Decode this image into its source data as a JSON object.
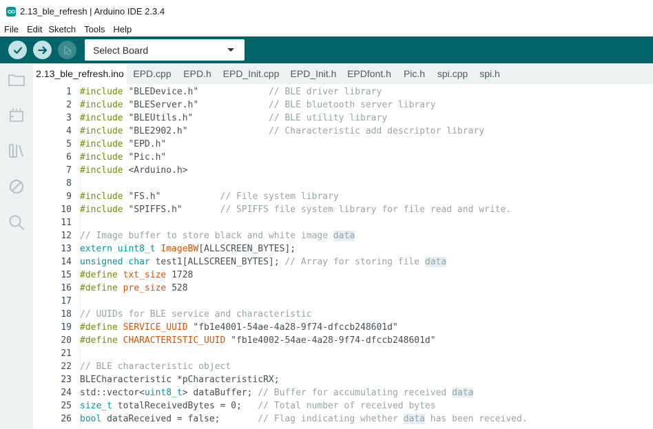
{
  "window": {
    "title": "2.13_ble_refresh | Arduino IDE 2.3.4"
  },
  "menu": [
    "File",
    "Edit",
    "Sketch",
    "Tools",
    "Help"
  ],
  "toolbar": {
    "verify_icon": "check-icon",
    "upload_icon": "arrow-right-icon",
    "debug_icon": "debug-icon",
    "board_select": "Select Board"
  },
  "sidebar": {
    "items": [
      "folder-icon",
      "board-icon",
      "library-icon",
      "debug-icon",
      "search-icon"
    ]
  },
  "tabs": [
    "2.13_ble_refresh.ino",
    "EPD.cpp",
    "EPD.h",
    "EPD_Init.cpp",
    "EPD_Init.h",
    "EPDfont.h",
    "Pic.h",
    "spi.cpp",
    "spi.h"
  ],
  "active_tab": "2.13_ble_refresh.ino",
  "colors": {
    "toolbar": "#006468",
    "keyword": "#728e00",
    "type": "#00979c",
    "comment": "#95a5a6",
    "define": "#d35400"
  },
  "code": [
    {
      "n": "1",
      "segs": [
        [
          "kw",
          "#include "
        ],
        [
          "str",
          "\"BLEDevice.h\""
        ],
        [
          "plain",
          "             "
        ],
        [
          "cmt",
          "// BLE driver library"
        ]
      ]
    },
    {
      "n": "2",
      "segs": [
        [
          "kw",
          "#include "
        ],
        [
          "str",
          "\"BLEServer.h\""
        ],
        [
          "plain",
          "             "
        ],
        [
          "cmt",
          "// BLE bluetooth server library"
        ]
      ]
    },
    {
      "n": "3",
      "segs": [
        [
          "kw",
          "#include "
        ],
        [
          "str",
          "\"BLEUtils.h\""
        ],
        [
          "plain",
          "              "
        ],
        [
          "cmt",
          "// BLE utility library"
        ]
      ]
    },
    {
      "n": "4",
      "segs": [
        [
          "kw",
          "#include "
        ],
        [
          "str",
          "\"BLE2902.h\""
        ],
        [
          "plain",
          "               "
        ],
        [
          "cmt",
          "// Characteristic add descriptor library"
        ]
      ]
    },
    {
      "n": "5",
      "segs": [
        [
          "kw",
          "#include "
        ],
        [
          "str",
          "\"EPD.h\""
        ]
      ]
    },
    {
      "n": "6",
      "segs": [
        [
          "kw",
          "#include "
        ],
        [
          "str",
          "\"Pic.h\""
        ]
      ]
    },
    {
      "n": "7",
      "segs": [
        [
          "kw",
          "#include "
        ],
        [
          "str",
          "<Arduino.h>"
        ]
      ]
    },
    {
      "n": "8",
      "segs": []
    },
    {
      "n": "9",
      "segs": [
        [
          "kw",
          "#include "
        ],
        [
          "str",
          "\"FS.h\""
        ],
        [
          "plain",
          "           "
        ],
        [
          "cmt",
          "// File system library"
        ]
      ]
    },
    {
      "n": "10",
      "segs": [
        [
          "kw",
          "#include "
        ],
        [
          "str",
          "\"SPIFFS.h\""
        ],
        [
          "plain",
          "       "
        ],
        [
          "cmt",
          "// SPIFFS file system library for file read and write."
        ]
      ]
    },
    {
      "n": "11",
      "segs": []
    },
    {
      "n": "12",
      "segs": [
        [
          "cmt",
          "// Image buffer to store black and white image "
        ],
        [
          "cmt-hl",
          "data"
        ]
      ]
    },
    {
      "n": "13",
      "segs": [
        [
          "type",
          "extern uint8_t "
        ],
        [
          "def",
          "ImageBW"
        ],
        [
          "plain",
          "[ALLSCREEN_BYTES];"
        ]
      ]
    },
    {
      "n": "14",
      "segs": [
        [
          "type",
          "unsigned char "
        ],
        [
          "plain",
          "test1[ALLSCREEN_BYTES]; "
        ],
        [
          "cmt",
          "// Array for storing file "
        ],
        [
          "cmt-hl",
          "data"
        ]
      ]
    },
    {
      "n": "15",
      "segs": [
        [
          "kw",
          "#define "
        ],
        [
          "def",
          "txt_size "
        ],
        [
          "num",
          "1728"
        ]
      ]
    },
    {
      "n": "16",
      "segs": [
        [
          "kw",
          "#define "
        ],
        [
          "def",
          "pre_size "
        ],
        [
          "num",
          "528"
        ]
      ]
    },
    {
      "n": "17",
      "segs": []
    },
    {
      "n": "18",
      "segs": [
        [
          "cmt",
          "// UUIDs for BLE service and characteristic"
        ]
      ]
    },
    {
      "n": "19",
      "segs": [
        [
          "kw",
          "#define "
        ],
        [
          "def",
          "SERVICE_UUID "
        ],
        [
          "str",
          "\"fb1e4001-54ae-4a28-9f74-dfccb248601d\""
        ]
      ]
    },
    {
      "n": "20",
      "segs": [
        [
          "kw",
          "#define "
        ],
        [
          "def",
          "CHARACTERISTIC_UUID "
        ],
        [
          "str",
          "\"fb1e4002-54ae-4a28-9f74-dfccb248601d\""
        ]
      ]
    },
    {
      "n": "21",
      "segs": []
    },
    {
      "n": "22",
      "segs": [
        [
          "cmt",
          "// BLE characteristic object"
        ]
      ]
    },
    {
      "n": "23",
      "segs": [
        [
          "plain",
          "BLECharacteristic *pCharacteristicRX;"
        ]
      ]
    },
    {
      "n": "24",
      "segs": [
        [
          "plain",
          "std::vector<"
        ],
        [
          "type",
          "uint8_t"
        ],
        [
          "plain",
          "> dataBuffer; "
        ],
        [
          "cmt",
          "// Buffer for accumulating received "
        ],
        [
          "cmt-hl",
          "data"
        ]
      ]
    },
    {
      "n": "25",
      "segs": [
        [
          "type",
          "size_t "
        ],
        [
          "plain",
          "totalReceivedBytes = 0;   "
        ],
        [
          "cmt",
          "// Total number of received bytes"
        ]
      ]
    },
    {
      "n": "26",
      "segs": [
        [
          "type",
          "bool "
        ],
        [
          "plain",
          "dataReceived = false;       "
        ],
        [
          "cmt",
          "// Flag indicating whether "
        ],
        [
          "cmt-hl",
          "data"
        ],
        [
          "cmt",
          " has been received."
        ]
      ]
    }
  ]
}
